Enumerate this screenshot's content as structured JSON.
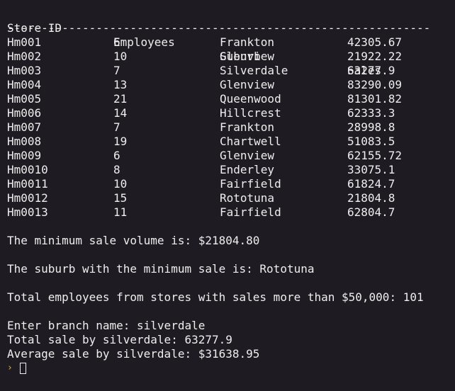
{
  "table": {
    "headers": {
      "store_id": "Store ID",
      "employees": "Employees",
      "suburb": "Suburb",
      "sales": "Sales"
    },
    "separator": "----------------------------------------------------------------",
    "rows": [
      {
        "id": "Hm001",
        "employees": "6",
        "suburb": "Frankton",
        "sales": "42305.67"
      },
      {
        "id": "Hm002",
        "employees": "10",
        "suburb": "Glenview",
        "sales": "21922.22"
      },
      {
        "id": "Hm003",
        "employees": "7",
        "suburb": "Silverdale",
        "sales": "63277.9"
      },
      {
        "id": "Hm004",
        "employees": "13",
        "suburb": "Glenview",
        "sales": "83290.09"
      },
      {
        "id": "Hm005",
        "employees": "21",
        "suburb": "Queenwood",
        "sales": "81301.82"
      },
      {
        "id": "Hm006",
        "employees": "14",
        "suburb": "Hillcrest",
        "sales": "62333.3"
      },
      {
        "id": "Hm007",
        "employees": "7",
        "suburb": "Frankton",
        "sales": "28998.8"
      },
      {
        "id": "Hm008",
        "employees": "19",
        "suburb": "Chartwell",
        "sales": "51083.5"
      },
      {
        "id": "Hm009",
        "employees": "6",
        "suburb": "Glenview",
        "sales": "62155.72"
      },
      {
        "id": "Hm0010",
        "employees": "8",
        "suburb": "Enderley",
        "sales": "33075.1"
      },
      {
        "id": "Hm0011",
        "employees": "10",
        "suburb": "Fairfield",
        "sales": "61824.7"
      },
      {
        "id": "Hm0012",
        "employees": "15",
        "suburb": "Rototuna",
        "sales": "21804.8"
      },
      {
        "id": "Hm0013",
        "employees": "11",
        "suburb": "Fairfield",
        "sales": "62804.7"
      }
    ]
  },
  "output": {
    "min_sale": "The minimum sale volume is: $21804.80",
    "min_suburb": "The suburb with the minimum sale is: Rototuna",
    "total_employees": "Total employees from stores with sales more than $50,000: 101",
    "enter_branch": "Enter branch name: silverdale",
    "total_sale": "Total sale by silverdale: 63277.9",
    "average_sale": "Average sale by silverdale: $31638.95"
  },
  "prompt": {
    "glyph": "›",
    "color": "#d9b23a"
  }
}
